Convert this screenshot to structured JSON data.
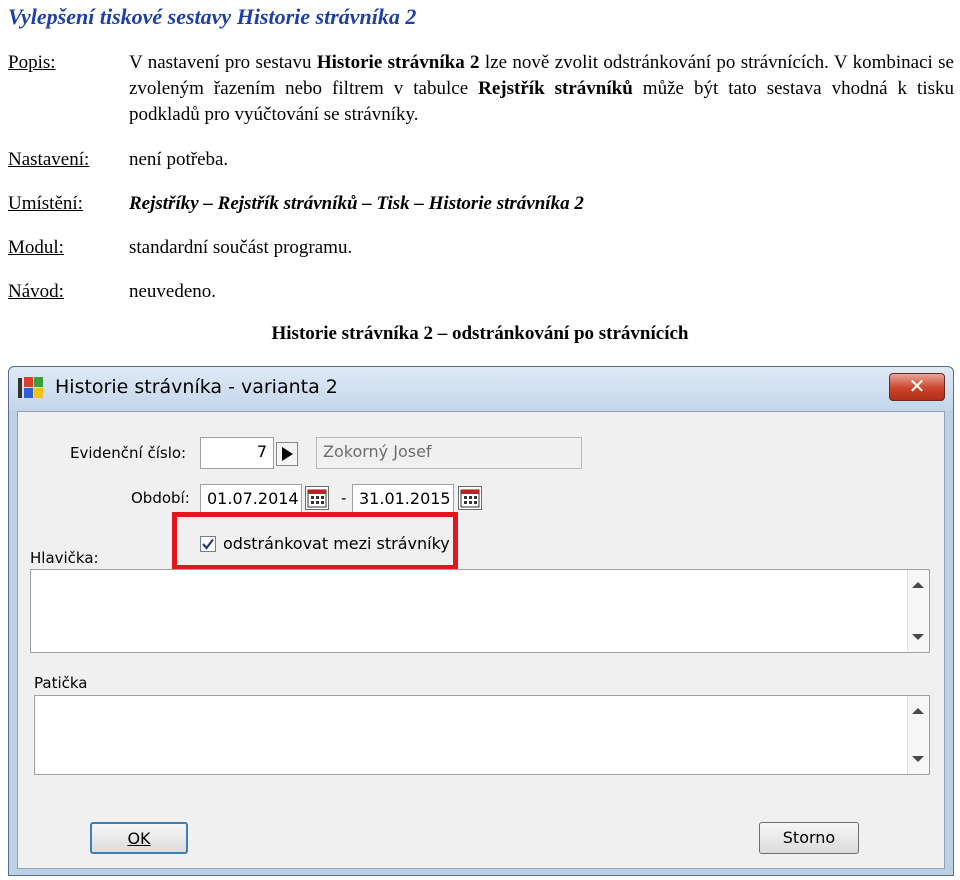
{
  "doc": {
    "title": "Vylepšení tiskové sestavy Historie strávníka 2",
    "popis_label": "Popis:",
    "popis_p1": "V nastavení pro sestavu ",
    "popis_b1": "Historie strávníka 2",
    "popis_p2": " lze nově zvolit odstránkování po strávnících. V kombinaci se zvoleným řazením nebo filtrem v tabulce ",
    "popis_b2": "Rejstřík strávníků",
    "popis_p3": " může být tato sestava vhodná k tisku podkladů pro vyúčtování se strávníky.",
    "nastaveni_label": "Nastavení:",
    "nastaveni_value": "není potřeba.",
    "umisteni_label": "Umístění:",
    "umisteni_value": "Rejstříky – Rejstřík strávníků – Tisk – Historie strávníka 2",
    "modul_label": "Modul:",
    "modul_value": "standardní součást programu.",
    "navod_label": "Návod:",
    "navod_value": "neuvedeno.",
    "caption": "Historie strávníka 2 – odstránkování po strávnících"
  },
  "dialog": {
    "title": "Historie strávníka - varianta 2",
    "close_glyph": "✕",
    "evidencni_label": "Evidenční číslo:",
    "evidencni_value": "7",
    "name_value": "Zokorný Josef",
    "obdobi_label": "Období:",
    "date_from": "01.07.2014",
    "date_separator": "-",
    "date_to": "31.01.2015",
    "checkbox_label": "odstránkovat mezi strávníky",
    "checkbox_checked": true,
    "hlavicka_label": "Hlavička:",
    "paticka_label": "Patička",
    "ok_label": "OK",
    "storno_label": "Storno"
  },
  "colors": {
    "title_blue": "#1f3fa8",
    "highlight_red": "#e4151d"
  }
}
